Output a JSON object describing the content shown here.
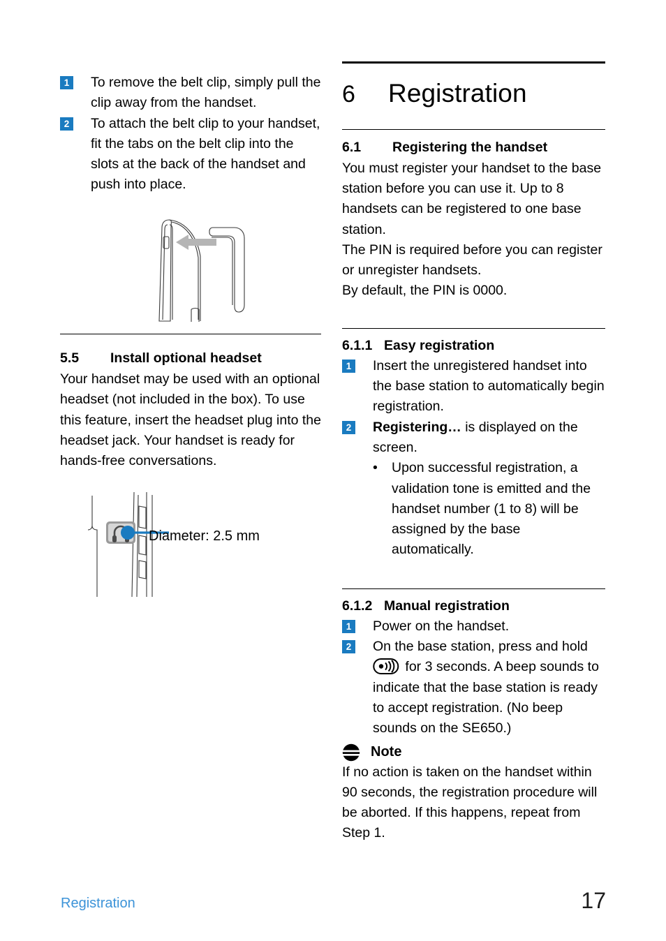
{
  "document": {
    "left_column": {
      "steps_belt_clip": [
        {
          "num": "1",
          "text": "To remove the belt clip, simply pull the clip away from the handset."
        },
        {
          "num": "2",
          "text": "To attach the belt clip to your handset, fit the tabs on the belt clip into the slots at the back of the handset and push into place."
        }
      ],
      "figure_belt_clip": {
        "name": "belt-clip-illustration",
        "arrow_color": "#b0b0b0",
        "line_color": "#2b2b2b"
      },
      "section_5_5": {
        "number": "5.5",
        "title": "Install optional headset",
        "body": "Your handset may be used with an optional headset (not included in the box). To use this feature, insert the headset plug into the headset jack. Your handset is ready for hands-free conversations."
      },
      "figure_headset": {
        "name": "headset-jack-illustration",
        "caption": "Diameter: 2.5 mm",
        "callout_color": "#1a7bc0",
        "jack_icon_color": "#8c8c8c"
      }
    },
    "right_column": {
      "chapter": {
        "number": "6",
        "title": "Registration"
      },
      "section_6_1": {
        "number": "6.1",
        "title": "Registering the handset",
        "paragraphs": [
          "You must register your handset to the base station before you can use it. Up to 8 handsets can be registered to one base station.",
          "The PIN is required before you can register or unregister handsets.",
          "By default, the PIN is 0000."
        ]
      },
      "section_6_1_1": {
        "number": "6.1.1",
        "title": "Easy registration",
        "steps": [
          {
            "num": "1",
            "text": "Insert the unregistered handset into the base station to automatically begin registration."
          },
          {
            "num": "2",
            "bold_lead": "Registering…",
            "text": " is displayed on the screen."
          }
        ],
        "bullets": [
          "Upon successful registration, a validation tone is emitted and the handset number (1 to 8) will be assigned by the base automatically."
        ]
      },
      "section_6_1_2": {
        "number": "6.1.2",
        "title": "Manual registration",
        "steps": [
          {
            "num": "1",
            "text": "Power on the handset."
          },
          {
            "num": "2",
            "text_before_icon": "On the base station, press and hold ",
            "icon": "paging-key-icon",
            "text_after_icon": " for 3 seconds. A beep sounds to indicate that the base station is ready to accept registration. (No beep sounds on the SE650.)"
          }
        ],
        "note": {
          "icon": "note-icon",
          "label": "Note",
          "text": "If no action is taken on the handset within 90 seconds, the registration procedure will be aborted. If this happens, repeat from Step 1."
        }
      }
    },
    "footer": {
      "left_label": "Registration",
      "page_number": "17",
      "left_color": "#3c93d8"
    },
    "colors": {
      "badge_blue": "#1a7bc0",
      "footer_blue": "#3c93d8",
      "text_black": "#000000"
    }
  }
}
